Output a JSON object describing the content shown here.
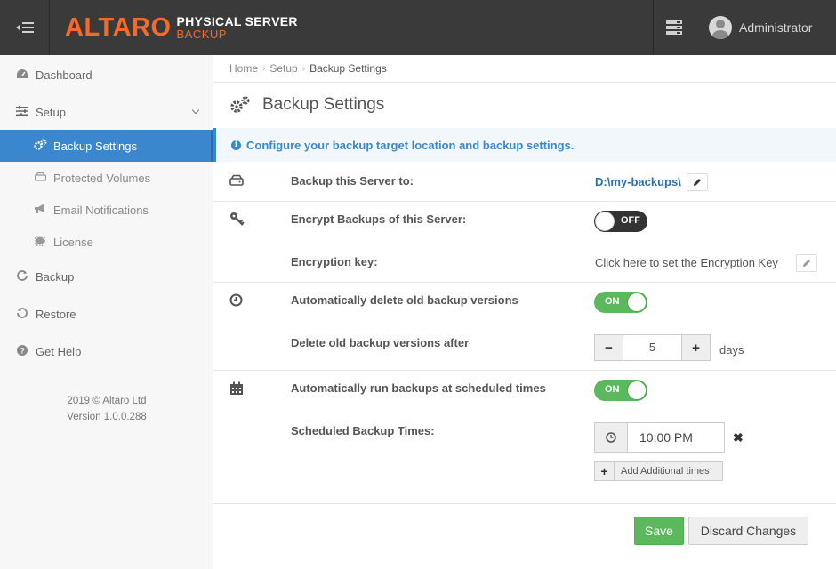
{
  "topbar": {
    "logo_main": "ALTARO",
    "logo_line1": "PHYSICAL SERVER",
    "logo_line2": "BACKUP",
    "user_name": "Administrator"
  },
  "sidebar": {
    "items": [
      {
        "label": "Dashboard",
        "icon": "dashboard-icon"
      },
      {
        "label": "Setup",
        "icon": "sliders-icon"
      },
      {
        "label": "Backup Settings",
        "icon": "cogs-icon"
      },
      {
        "label": "Protected Volumes",
        "icon": "drive-icon"
      },
      {
        "label": "Email Notifications",
        "icon": "megaphone-icon"
      },
      {
        "label": "License",
        "icon": "certificate-icon"
      },
      {
        "label": "Backup",
        "icon": "refresh-icon"
      },
      {
        "label": "Restore",
        "icon": "undo-icon"
      },
      {
        "label": "Get Help",
        "icon": "question-icon"
      }
    ],
    "copyright": "2019 © Altaro Ltd",
    "version": "Version 1.0.0.288"
  },
  "breadcrumb": [
    "Home",
    "Setup",
    "Backup Settings"
  ],
  "page_title": "Backup Settings",
  "info_text": "Configure your backup target location and backup settings.",
  "settings": {
    "backup_to_label": "Backup this Server to:",
    "backup_to_value": "D:\\my-backups\\",
    "encrypt_label": "Encrypt Backups of this Server:",
    "encrypt_state": "OFF",
    "encryption_key_label": "Encryption key:",
    "encryption_key_value": "Click here to set the Encryption Key",
    "auto_delete_label": "Automatically delete old backup versions",
    "auto_delete_state": "ON",
    "delete_after_label": "Delete old backup versions after",
    "delete_after_value": "5",
    "delete_after_unit": "days",
    "schedule_label": "Automatically run backups at scheduled times",
    "schedule_state": "ON",
    "schedule_times_label": "Scheduled Backup Times:",
    "schedule_time": "10:00 PM",
    "add_times_label": "Add Additional times"
  },
  "buttons": {
    "save": "Save",
    "discard": "Discard Changes"
  },
  "colors": {
    "accent": "#3a87d0",
    "brand_orange": "#f26b2b",
    "success": "#5cb85c",
    "topbar": "#3a3a3a"
  }
}
